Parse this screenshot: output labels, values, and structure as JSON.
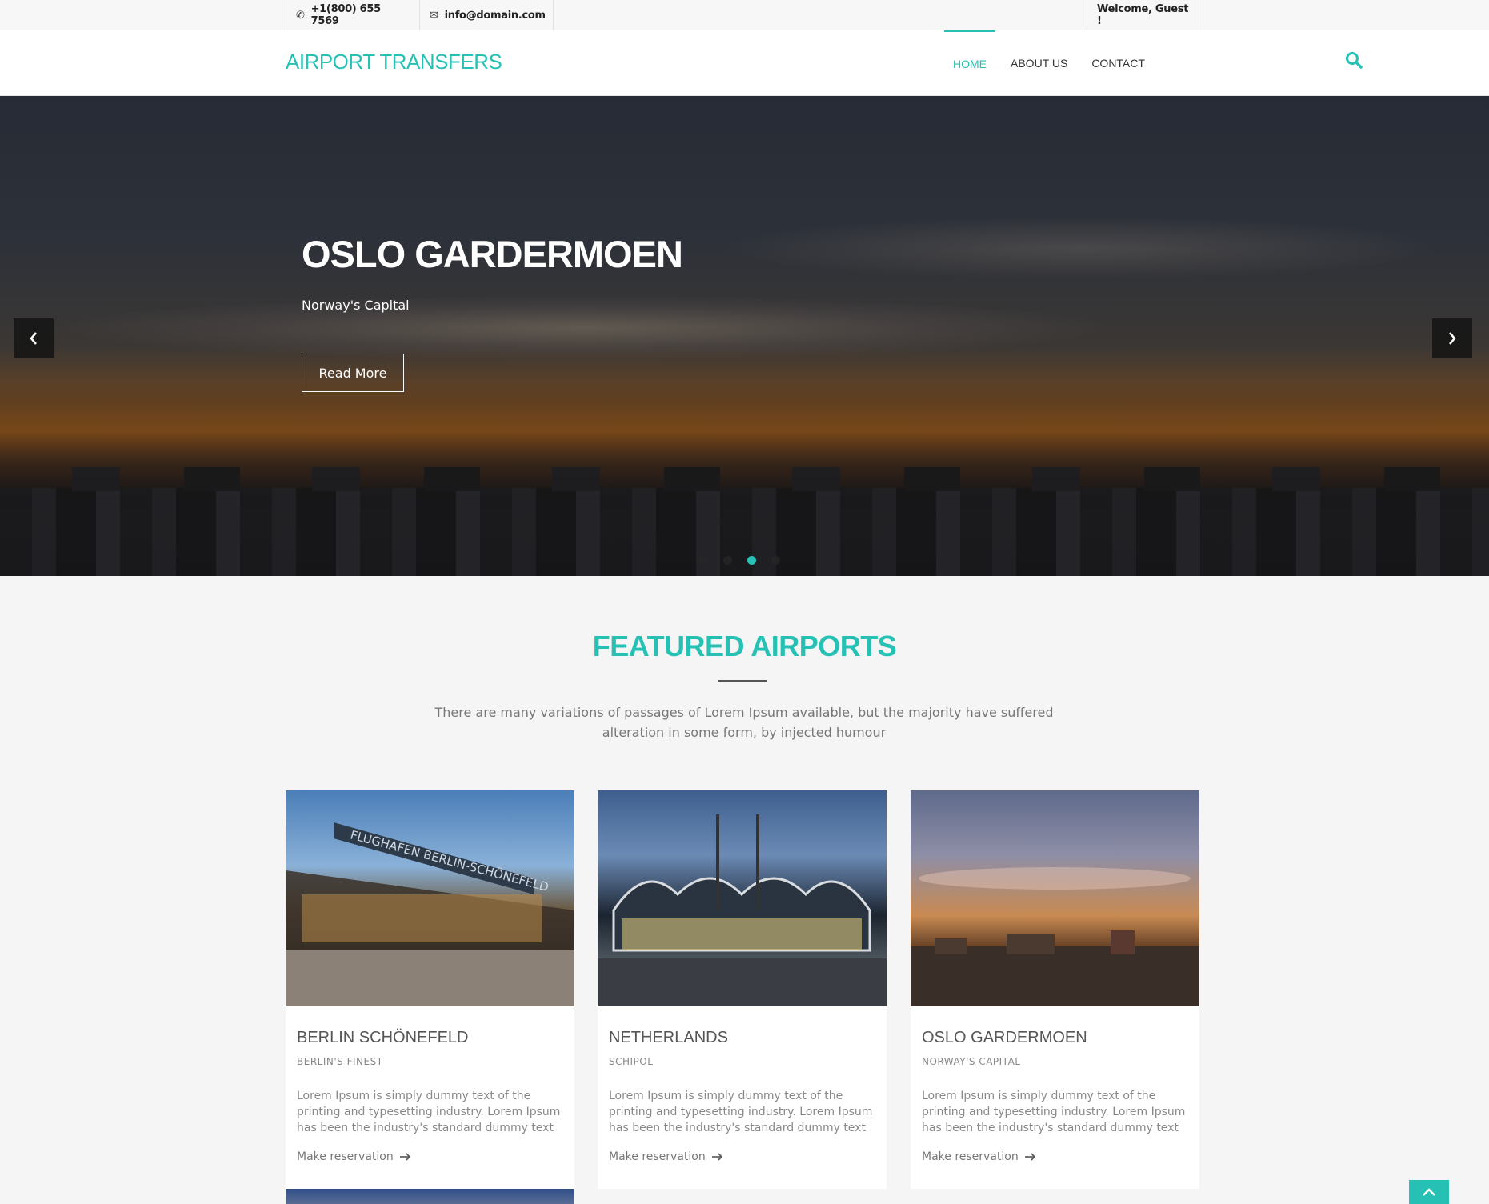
{
  "topbar": {
    "phone": "+1(800) 655 7569",
    "email": "info@domain.com",
    "welcome": "Welcome, Guest !"
  },
  "header": {
    "logo": "AIRPORT TRANSFERS",
    "nav": [
      {
        "label": "HOME",
        "active": true
      },
      {
        "label": "ABOUT US",
        "active": false
      },
      {
        "label": "CONTACT",
        "active": false
      }
    ]
  },
  "hero": {
    "title": "OSLO GARDERMOEN",
    "subtitle": "Norway's Capital",
    "button": "Read More",
    "slides": 4,
    "active_slide": 3
  },
  "featured": {
    "title": "FEATURED AIRPORTS",
    "description": "There are many variations of passages of Lorem Ipsum available, but the majority have suffered alteration in some form, by injected humour",
    "cards": [
      {
        "title": "BERLIN SCHÖNEFELD",
        "tag": "BERLIN'S FINEST",
        "text": "Lorem Ipsum is simply dummy text of the printing and typesetting industry. Lorem Ipsum has been the industry's standard dummy text ever since the",
        "link": "Make reservation",
        "sign": "FLUGHAFEN BERLIN-SCHÖNEFELD"
      },
      {
        "title": "NETHERLANDS",
        "tag": "SCHIPOL",
        "text": "Lorem Ipsum is simply dummy text of the printing and typesetting industry. Lorem Ipsum has been the industry's standard dummy text ever since the",
        "link": "Make reservation"
      },
      {
        "title": "OSLO GARDERMOEN",
        "tag": "NORWAY'S CAPITAL",
        "text": "Lorem Ipsum is simply dummy text of the printing and typesetting industry. Lorem Ipsum has been the industry's standard dummy text ever since the",
        "link": "Make reservation"
      }
    ]
  },
  "colors": {
    "accent": "#26c0b4",
    "text": "#666666",
    "background": "#f5f5f5"
  },
  "icons": {
    "phone": "phone-icon",
    "email": "envelope-icon",
    "search": "search-icon",
    "prev": "chevron-left-icon",
    "next": "chevron-right-icon",
    "arrow": "arrow-right-icon",
    "top": "chevron-up-icon"
  }
}
